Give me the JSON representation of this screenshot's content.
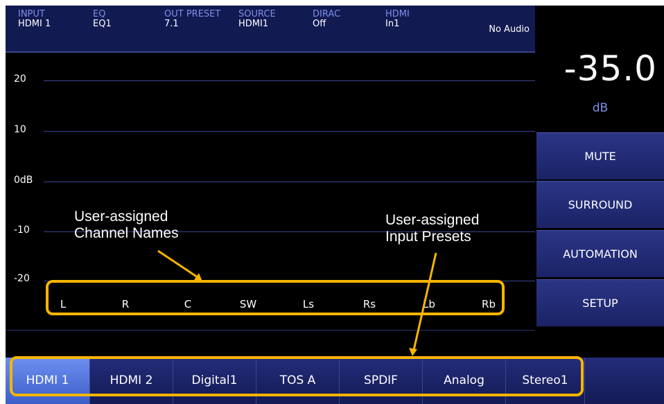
{
  "status": {
    "input": {
      "label": "INPUT",
      "value": "HDMI 1"
    },
    "eq": {
      "label": "EQ",
      "value": "EQ1"
    },
    "out_preset": {
      "label": "OUT PRESET",
      "value": "7.1"
    },
    "source": {
      "label": "SOURCE",
      "value": "HDMI1"
    },
    "dirac": {
      "label": "DIRAC",
      "value": "Off"
    },
    "hdmi": {
      "label": "HDMI",
      "value": "In1"
    },
    "audio": "No Audio"
  },
  "volume": {
    "value": "-35.0",
    "unit": "dB"
  },
  "meter": {
    "levels": [
      "20",
      "10",
      "0dB",
      "-10",
      "-20"
    ],
    "channels": [
      "L",
      "R",
      "C",
      "SW",
      "Ls",
      "Rs",
      "Lb",
      "Rb"
    ]
  },
  "side_buttons": [
    "MUTE",
    "SURROUND",
    "AUTOMATION",
    "SETUP"
  ],
  "input_tabs": {
    "items": [
      "HDMI 1",
      "HDMI 2",
      "Digital1",
      "TOS A",
      "SPDIF",
      "Analog",
      "Stereo1"
    ],
    "selected": "HDMI 1"
  },
  "annotations": {
    "channel_names": [
      "User-assigned",
      "Channel Names"
    ],
    "input_presets": [
      "User-assigned",
      "Input Presets"
    ],
    "highlight_color": "#f7b500"
  },
  "colors": {
    "panel": "#121a52",
    "accent_text": "#7e8fe6",
    "button": "#2a3585",
    "active_tab": "#6e8ff0"
  }
}
